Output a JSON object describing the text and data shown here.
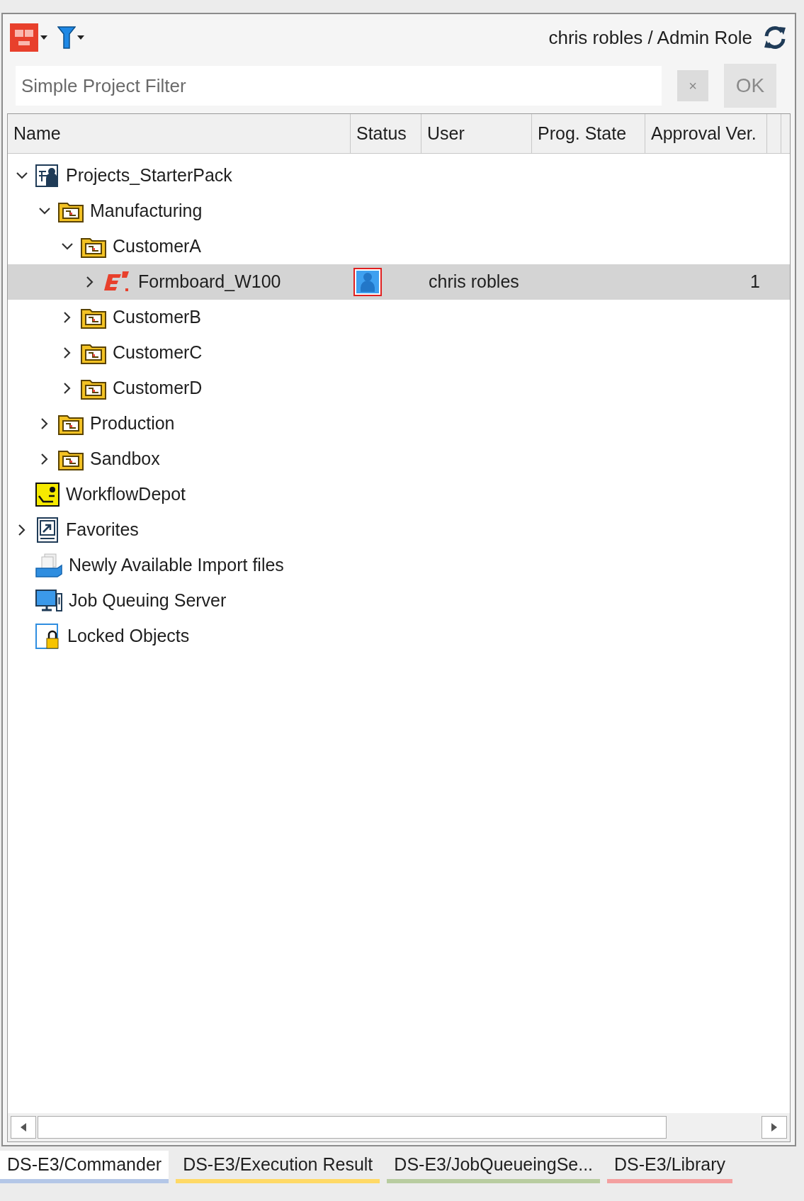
{
  "toolbar": {
    "user_role": "chris robles / Admin Role"
  },
  "filter": {
    "placeholder": "Simple Project Filter",
    "clear_button": "×",
    "ok_button": "OK"
  },
  "table": {
    "columns": [
      {
        "label": "Name"
      },
      {
        "label": "Status"
      },
      {
        "label": "User"
      },
      {
        "label": "Prog. State"
      },
      {
        "label": "Approval Ver."
      }
    ],
    "tree": [
      {
        "label": "Projects_StarterPack",
        "kind": "root",
        "expanded": true,
        "selected": false,
        "locked": false,
        "children": [
          {
            "label": "Manufacturing",
            "kind": "folder",
            "expanded": true,
            "selected": false,
            "locked": false,
            "children": [
              {
                "label": "CustomerA",
                "kind": "folder",
                "expanded": true,
                "selected": false,
                "locked": false,
                "children": [
                  {
                    "label": "Formboard_W100",
                    "kind": "project",
                    "expanded": false,
                    "selected": true,
                    "locked": true,
                    "user": "chris robles",
                    "approval_ver": "1"
                  }
                ]
              },
              {
                "label": "CustomerB",
                "kind": "folder",
                "expanded": false,
                "selected": false,
                "locked": false
              },
              {
                "label": "CustomerC",
                "kind": "folder",
                "expanded": false,
                "selected": false,
                "locked": false
              },
              {
                "label": "CustomerD",
                "kind": "folder",
                "expanded": false,
                "selected": false,
                "locked": false
              }
            ]
          },
          {
            "label": "Production",
            "kind": "folder",
            "expanded": false,
            "selected": false,
            "locked": false
          },
          {
            "label": "Sandbox",
            "kind": "folder",
            "expanded": false,
            "selected": false,
            "locked": false
          }
        ]
      },
      {
        "label": "WorkflowDepot",
        "kind": "workflow",
        "selected": false,
        "locked": false
      },
      {
        "label": "Favorites",
        "kind": "favorites",
        "expanded": false,
        "selected": false,
        "locked": false
      },
      {
        "label": "Newly Available Import files",
        "kind": "import",
        "selected": false,
        "locked": false
      },
      {
        "label": "Job Queuing Server",
        "kind": "server",
        "selected": false,
        "locked": false
      },
      {
        "label": "Locked Objects",
        "kind": "lock",
        "selected": false,
        "locked": false
      }
    ]
  },
  "tabs": [
    {
      "label": "DS-E3/Commander",
      "selected": true,
      "color": "#b4c7e7"
    },
    {
      "label": "DS-E3/Execution Result",
      "selected": false,
      "color": "#ffd966"
    },
    {
      "label": "DS-E3/JobQueueingSe...",
      "selected": false,
      "color": "#b8cca0"
    },
    {
      "label": "DS-E3/Library",
      "selected": false,
      "color": "#f4a0a0"
    }
  ]
}
